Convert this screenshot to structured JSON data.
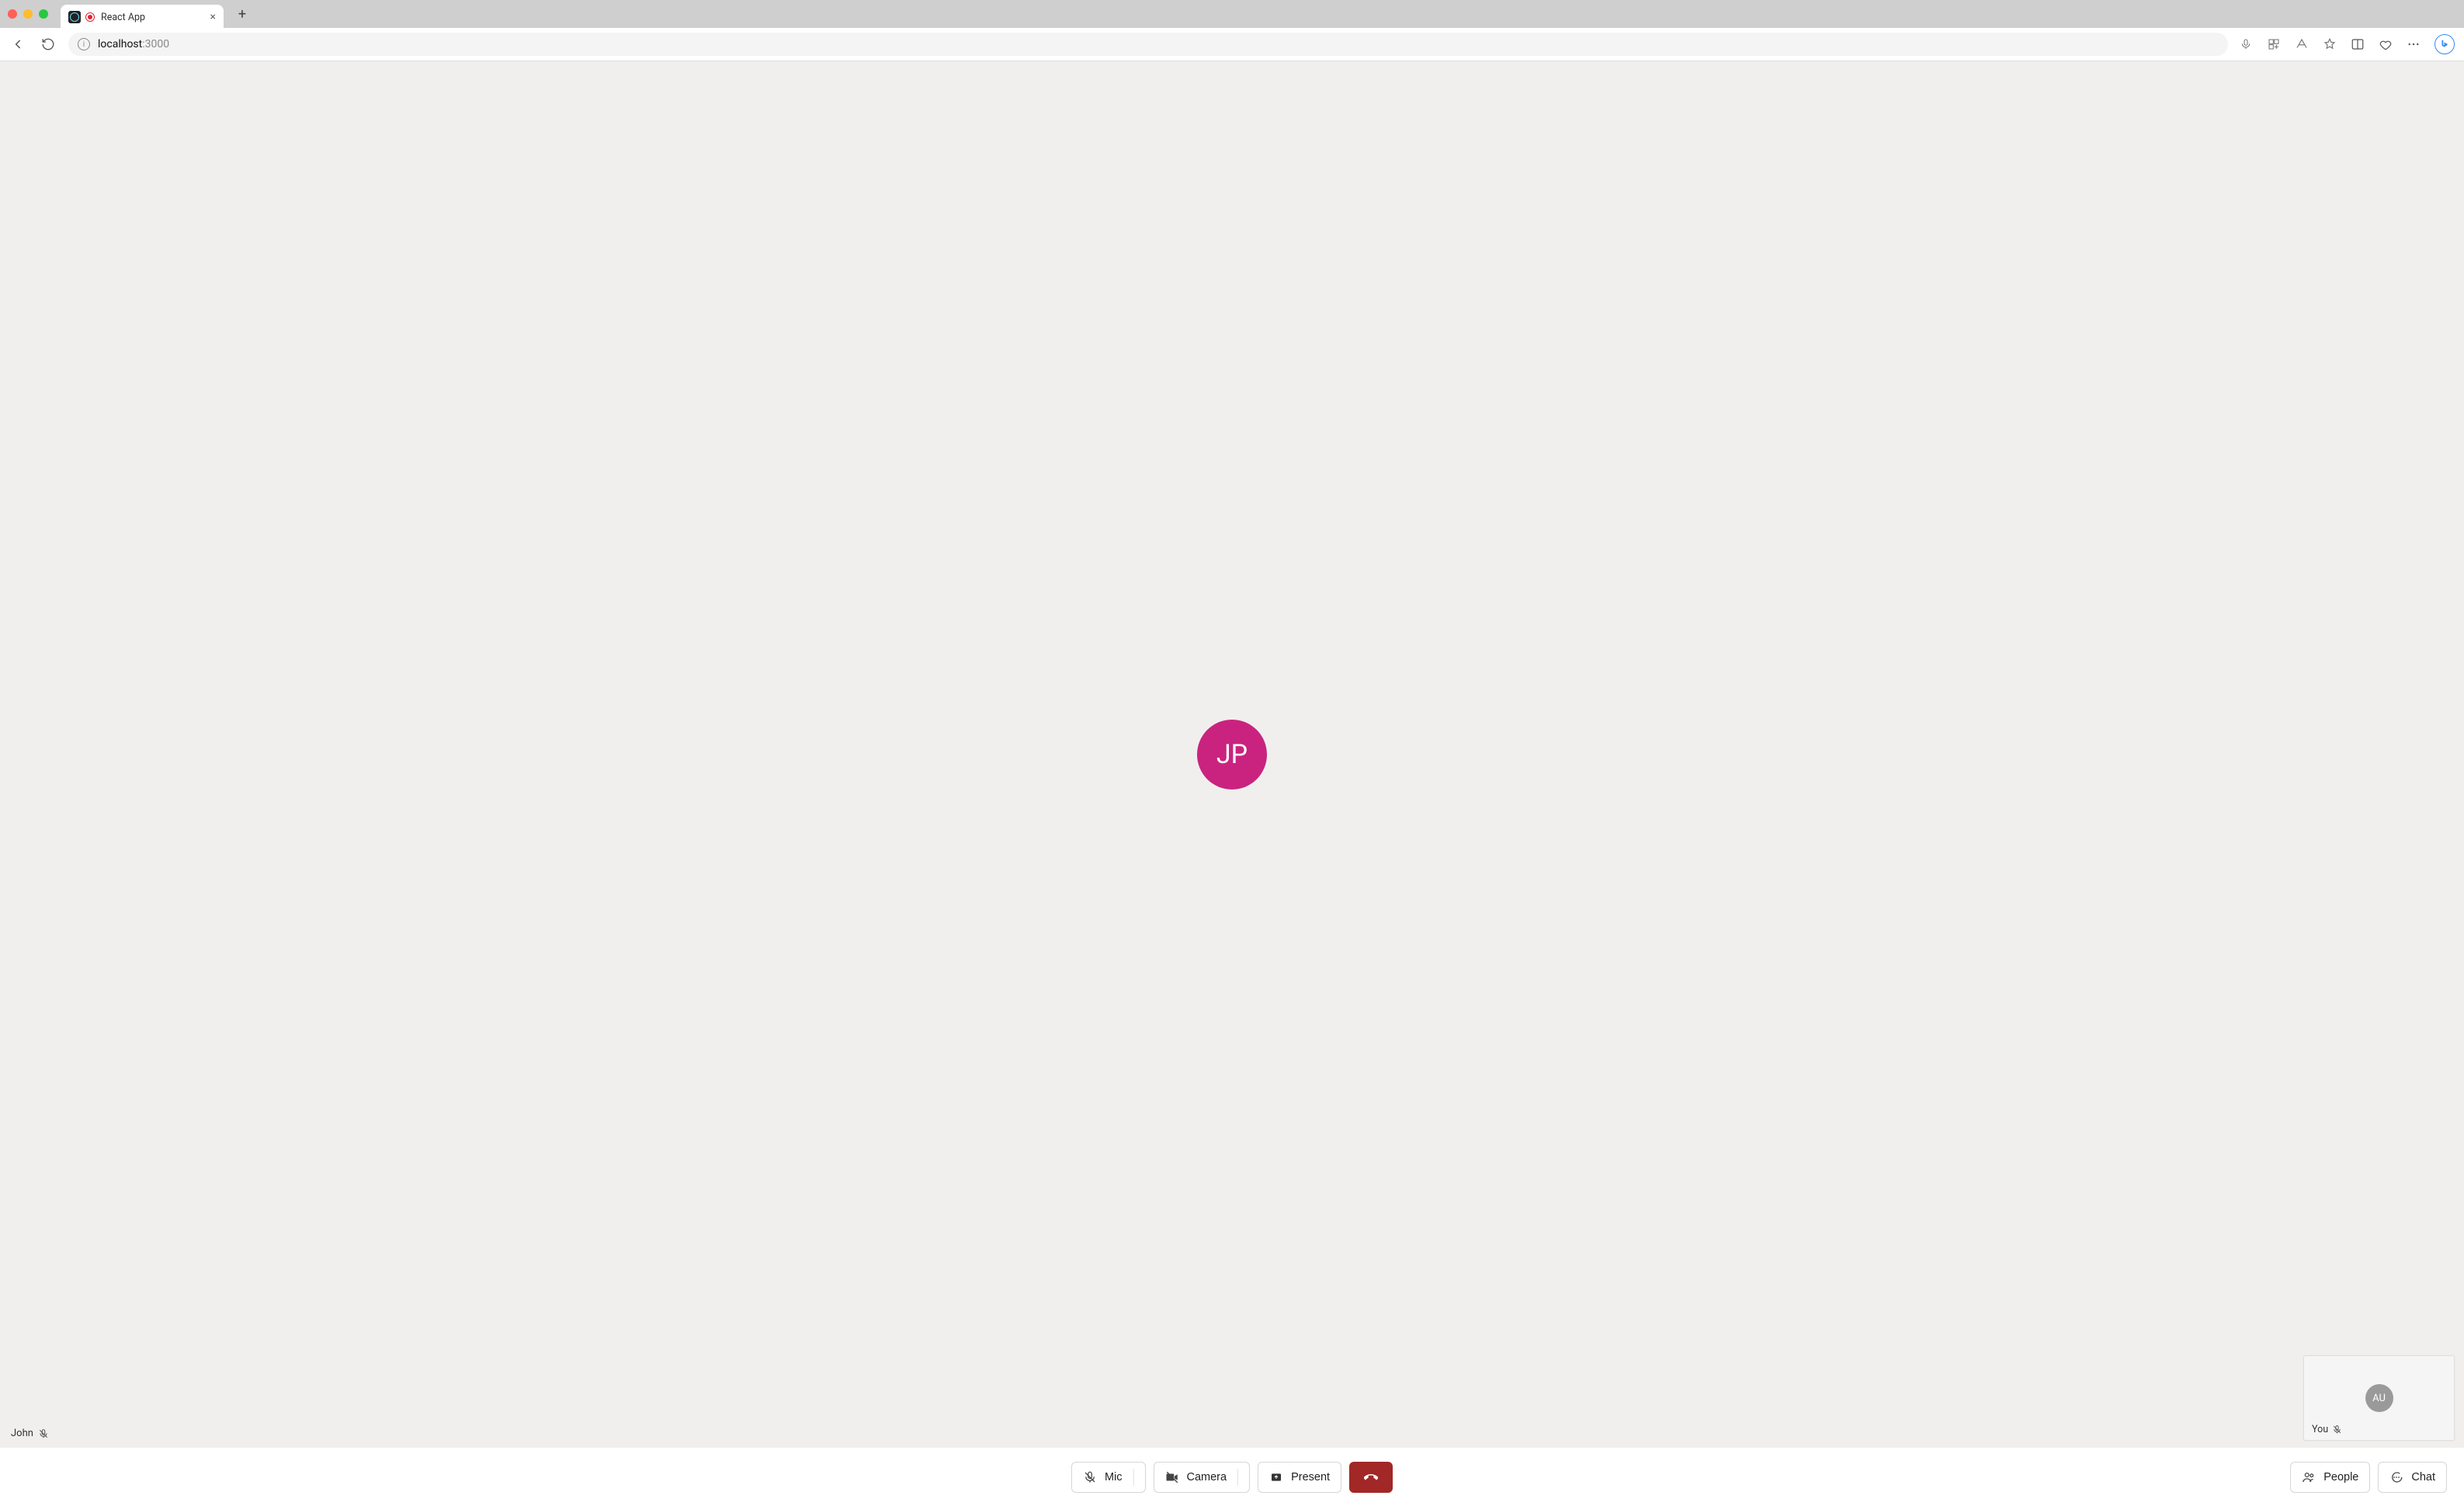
{
  "browser": {
    "tab_title": "React App",
    "url_host": "localhost",
    "url_port": ":3000"
  },
  "call": {
    "remote_participant": {
      "initials": "JP",
      "name_label": "John",
      "muted": true,
      "avatar_color": "#c9237f"
    },
    "self_participant": {
      "initials": "AU",
      "name_label": "You",
      "muted": true,
      "avatar_color": "#9a9a9a"
    }
  },
  "controls": {
    "mic_label": "Mic",
    "camera_label": "Camera",
    "present_label": "Present",
    "people_label": "People",
    "chat_label": "Chat"
  }
}
